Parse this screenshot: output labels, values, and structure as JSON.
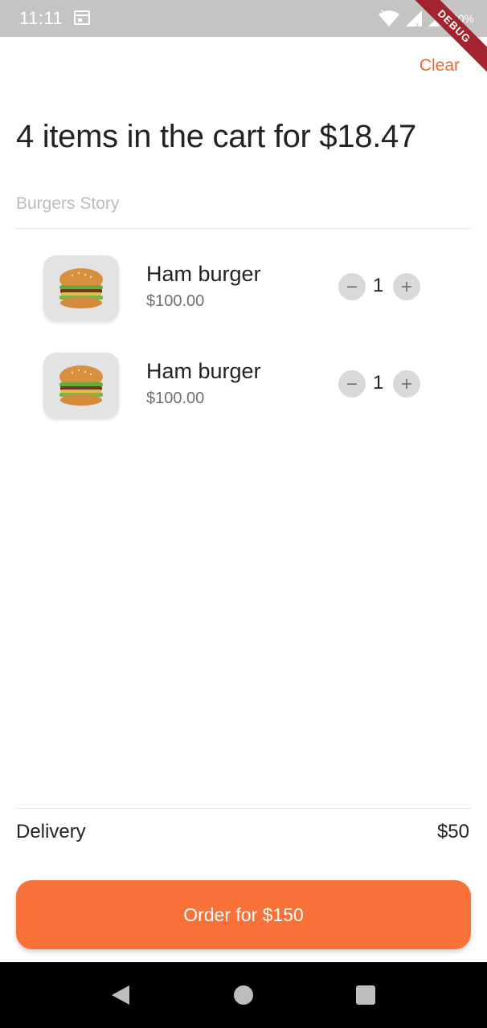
{
  "status_bar": {
    "time": "11:11",
    "battery": "40%",
    "icons": [
      "calendar-icon",
      "wifi-icon",
      "signal-icon",
      "signal-icon",
      "battery-icon"
    ]
  },
  "debug_banner": "DEBUG",
  "header": {
    "clear_label": "Clear"
  },
  "cart": {
    "title": "4 items in the cart for $18.47",
    "restaurant": "Burgers Story",
    "items": [
      {
        "name": "Ham burger",
        "price": "$100.00",
        "quantity": "1",
        "icon": "burger-icon"
      },
      {
        "name": "Ham burger",
        "price": "$100.00",
        "quantity": "1",
        "icon": "burger-icon"
      }
    ]
  },
  "delivery": {
    "label": "Delivery",
    "value": "$50"
  },
  "order_button": {
    "label": "Order for $150"
  },
  "colors": {
    "accent": "#f87139",
    "clear_text": "#f06a30",
    "muted_text": "#b9bcc4",
    "status_bar": "#c4c4c4",
    "debug_ribbon": "#a3232f"
  },
  "nav_bar": {
    "icons": [
      "back-icon",
      "home-icon",
      "recent-apps-icon"
    ]
  }
}
